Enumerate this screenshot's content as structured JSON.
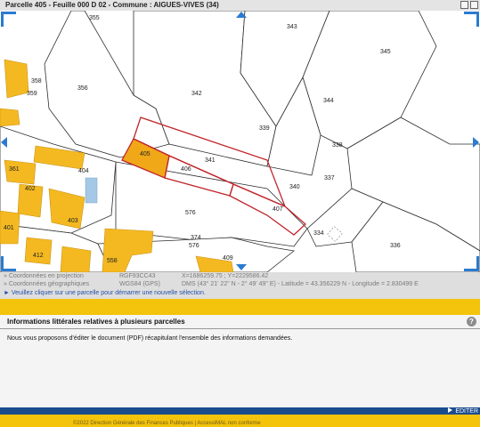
{
  "window": {
    "title": "Parcelle 405 - Feuille 000 D 02 - Commune : AIGUES-VIVES (34)"
  },
  "map": {
    "parcels": [
      "355",
      "343",
      "345",
      "358",
      "359",
      "356",
      "342",
      "344",
      "339",
      "338",
      "405",
      "341",
      "406",
      "404",
      "361",
      "402",
      "337",
      "340",
      "407",
      "576",
      "403",
      "401",
      "374",
      "576",
      "334",
      "336",
      "412",
      "558",
      "409"
    ],
    "colors": {
      "building": "#f4b921",
      "parcel_border": "#2d2d2d",
      "selection": "#c0262c",
      "water": "#a4c8e6",
      "nav": "#2b7bd0"
    }
  },
  "coordinates": {
    "projection_label": "» Coordonnées en projection",
    "projection_system": "RGF93CC43",
    "projection_value": "X=1686259.75 ; Y=2229586.42",
    "geo_label": "» Coordonnées géographiques",
    "geo_system": "WGS84 (GPS)",
    "geo_value": "DMS (43° 21' 22\" N - 2° 49' 49\" E) - Latitude = 43.356229 N - Longitude = 2.830499 E",
    "hint": "► Veuillez cliquer sur une parcelle pour démarrer une nouvelle sélection."
  },
  "panel": {
    "title": "Informations littérales relatives à plusieurs parcelles",
    "help": "?",
    "text": "Nous vous proposons d'éditer le document (PDF) récapitulant l'ensemble des informations demandées.",
    "edit_label": "EDITER"
  },
  "footer": {
    "text": "©2022 Direction Générale des Finances Publiques  |  AccessiMAL non conforme"
  }
}
